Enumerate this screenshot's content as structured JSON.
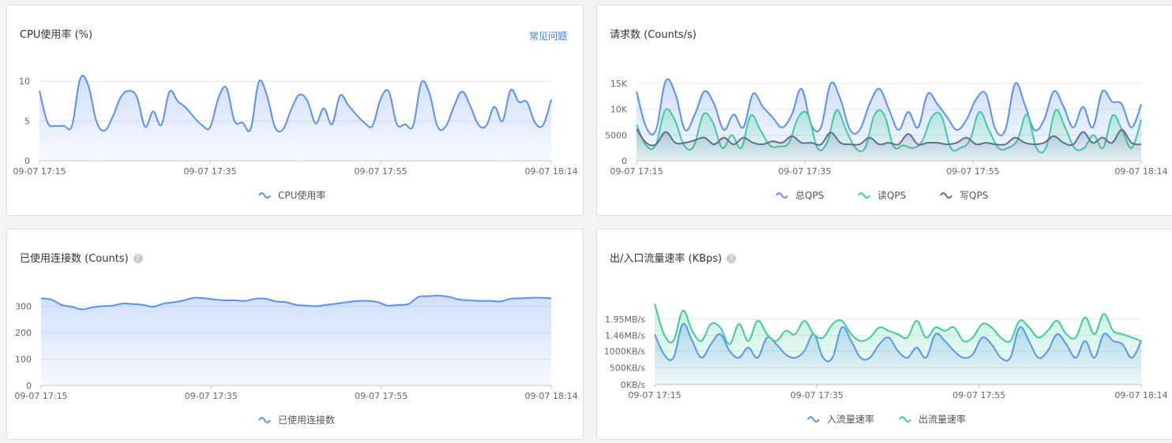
{
  "panels": [
    {
      "title": "CPU使用率 (%)",
      "link": "常见问题",
      "chart_data": {
        "type": "area",
        "x": [
          "09-07 17:15",
          "09-07 17:35",
          "09-07 17:55",
          "09-07 18:14"
        ],
        "ylim": [
          0,
          11
        ],
        "yticks": [
          0,
          5,
          10
        ],
        "grid": true,
        "legend": "bottom",
        "series": [
          {
            "name": "CPU使用率",
            "color": "#5b8ff9",
            "values": [
              8.8,
              4.8,
              4.4,
              4.4,
              4.4,
              10.3,
              9.5,
              5,
              3.8,
              5.5,
              8,
              8.8,
              8,
              4.3,
              6.2,
              4.5,
              8.7,
              7.5,
              6.7,
              5.5,
              4.5,
              4.2,
              7.8,
              9.2,
              5,
              4.8,
              4,
              9.9,
              8.2,
              4.2,
              4,
              6.5,
              8.3,
              7.5,
              4.7,
              6.6,
              4.6,
              8.2,
              7,
              5.8,
              4.8,
              4.4,
              7.8,
              8.7,
              4.6,
              4.6,
              4.4,
              9.8,
              8.5,
              4.3,
              4.3,
              6.8,
              8.7,
              7,
              4.6,
              4.4,
              6.8,
              5,
              8.9,
              7.4,
              7.4,
              4.8,
              4.5,
              7.7
            ]
          }
        ]
      }
    },
    {
      "title": "请求数 (Counts/s)",
      "chart_data": {
        "type": "area",
        "x": [
          "09-07 17:15",
          "09-07 17:35",
          "09-07 17:55",
          "09-07 18:14"
        ],
        "ylim": [
          0,
          17000
        ],
        "yticks": [
          0,
          5000,
          10000,
          15000
        ],
        "ytick_labels": [
          "0",
          "5000",
          "10K",
          "15K"
        ],
        "grid": true,
        "legend": "bottom",
        "series": [
          {
            "name": "总QPS",
            "color": "#5b8ff9",
            "values": [
              13500,
              6500,
              6000,
              15500,
              13000,
              6000,
              9000,
              13500,
              11000,
              6000,
              9000,
              6500,
              13000,
              10500,
              8500,
              6500,
              9000,
              14000,
              7000,
              6500,
              15000,
              12000,
              6000,
              6000,
              11000,
              14000,
              10000,
              6000,
              9500,
              6500,
              13000,
              11000,
              8500,
              6000,
              8000,
              12000,
              13000,
              6000,
              6000,
              15000,
              11000,
              6000,
              8000,
              13500,
              10500,
              6500,
              10500,
              6500,
              13500,
              11500,
              11000,
              6500,
              11000
            ]
          },
          {
            "name": "读QPS",
            "color": "#3fcc9a",
            "values": [
              7000,
              3000,
              3000,
              9800,
              8000,
              3000,
              2800,
              9000,
              7500,
              2500,
              5000,
              2500,
              8800,
              6000,
              3000,
              2800,
              3500,
              8500,
              9000,
              2500,
              3500,
              9800,
              6000,
              2500,
              2500,
              9000,
              9000,
              2800,
              3000,
              2500,
              3800,
              8500,
              8800,
              2500,
              2500,
              4000,
              9500,
              6000,
              2500,
              2500,
              4000,
              9000,
              2500,
              2500,
              9800,
              6500,
              2500,
              2500,
              5000,
              2500,
              8800,
              6000,
              2500,
              8000
            ]
          },
          {
            "name": "写QPS",
            "color": "#5d7092",
            "values": [
              6200,
              3500,
              3200,
              5600,
              3500,
              3500,
              4000,
              4500,
              3200,
              4500,
              3200,
              4500,
              3500,
              3200,
              3800,
              3500,
              4800,
              3500,
              3500,
              3200,
              5500,
              3500,
              3200,
              3200,
              4500,
              3200,
              3500,
              3200,
              5200,
              3200,
              3500,
              3500,
              3200,
              3500,
              4500,
              3200,
              3500,
              3200,
              3200,
              4500,
              3500,
              3200,
              3500,
              4800,
              3500,
              3200,
              5600,
              3500,
              4500,
              3500,
              6000,
              3500,
              3200
            ]
          }
        ]
      }
    },
    {
      "title": "已使用连接数 (Counts)",
      "chart_data": {
        "type": "area",
        "x": [
          "09-07 17:15",
          "09-07 17:35",
          "09-07 17:55",
          "09-07 18:14"
        ],
        "ylim": [
          0,
          340
        ],
        "yticks": [
          0,
          100,
          200,
          300
        ],
        "grid": true,
        "legend": "bottom",
        "series": [
          {
            "name": "已使用连接数",
            "color": "#5b8ff9",
            "values": [
              330,
              325,
              305,
              298,
              288,
              295,
              300,
              302,
              310,
              308,
              305,
              298,
              310,
              315,
              322,
              332,
              330,
              325,
              322,
              322,
              320,
              328,
              328,
              318,
              315,
              305,
              302,
              300,
              305,
              310,
              315,
              320,
              320,
              315,
              302,
              305,
              308,
              335,
              338,
              340,
              335,
              325,
              322,
              320,
              320,
              318,
              328,
              330,
              332,
              332,
              330
            ]
          }
        ]
      }
    },
    {
      "title": "出/入口流量速率 (KBps)",
      "chart_data": {
        "type": "area",
        "x": [
          "09-07 17:15",
          "09-07 17:35",
          "09-07 17:55",
          "09-07 18:14"
        ],
        "ylim": [
          0,
          2600
        ],
        "yticks": [
          0,
          500,
          1000,
          1460,
          1950
        ],
        "ytick_labels": [
          "0KB/s",
          "500KB/s",
          "1000KB/s",
          "1.46MB/s",
          "1.95MB/s"
        ],
        "grid": true,
        "legend": "bottom",
        "series": [
          {
            "name": "入流量速率",
            "color": "#5b8ff9",
            "values": [
              1500,
              900,
              800,
              1800,
              1300,
              800,
              1200,
              1500,
              1000,
              800,
              1100,
              800,
              1400,
              1200,
              900,
              800,
              1000,
              1500,
              800,
              800,
              1700,
              1300,
              800,
              800,
              1200,
              1400,
              1000,
              800,
              1100,
              800,
              1500,
              1300,
              1000,
              800,
              900,
              1400,
              1200,
              800,
              800,
              1700,
              1300,
              800,
              1000,
              1500,
              1200,
              800,
              1300,
              800,
              1500,
              1300,
              1200,
              800,
              1300
            ]
          },
          {
            "name": "出流量速率",
            "color": "#3fcc9a",
            "values": [
              2400,
              1500,
              1300,
              2200,
              1600,
              1300,
              1800,
              1700,
              1200,
              1800,
              1300,
              1900,
              1500,
              1300,
              1600,
              1500,
              1900,
              1500,
              1400,
              1800,
              1900,
              1500,
              1300,
              1400,
              1700,
              1600,
              1500,
              1400,
              1900,
              1400,
              1700,
              1600,
              1700,
              1300,
              1400,
              1800,
              1700,
              1400,
              1300,
              1900,
              1700,
              1400,
              1600,
              1900,
              1500,
              1400,
              2000,
              1500,
              2100,
              1600,
              1500,
              1400,
              1300
            ]
          }
        ]
      }
    }
  ]
}
